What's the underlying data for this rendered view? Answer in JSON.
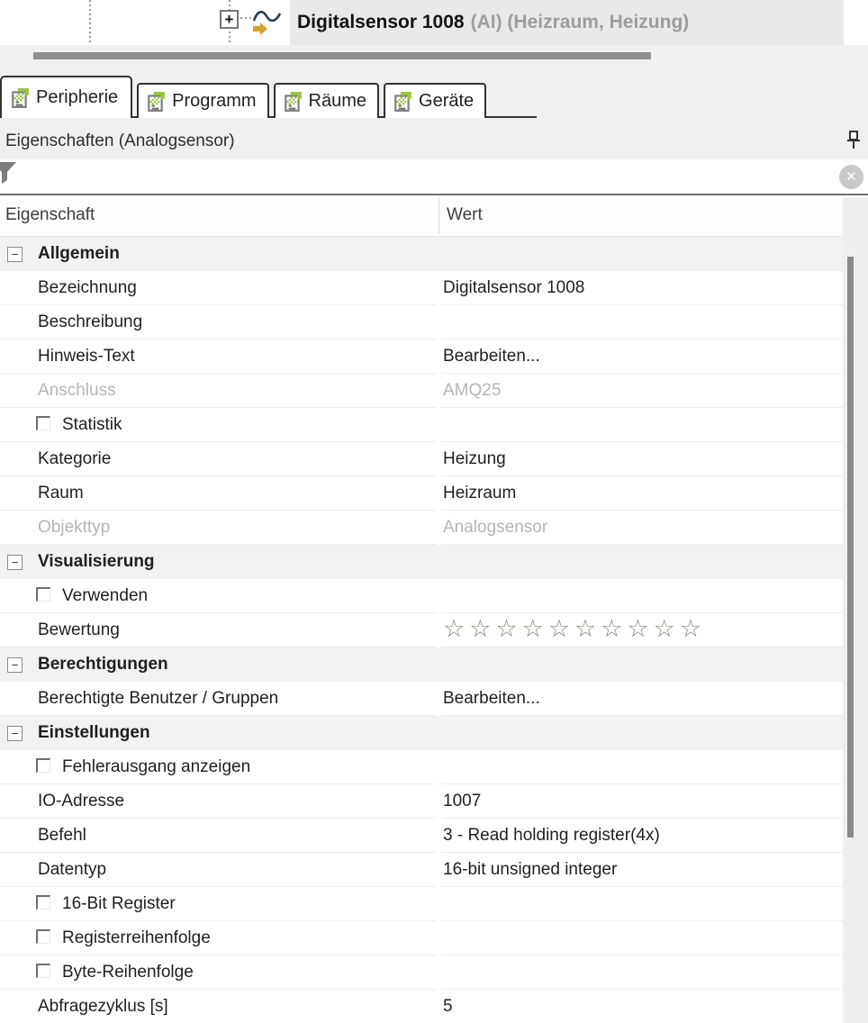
{
  "tree": {
    "item_title": "Digitalsensor 1008",
    "item_suffix": "(AI) (Heizraum, Heizung)"
  },
  "tabs": [
    {
      "label": "Peripherie",
      "active": true
    },
    {
      "label": "Programm",
      "active": false
    },
    {
      "label": "Räume",
      "active": false
    },
    {
      "label": "Geräte",
      "active": false
    }
  ],
  "panel": {
    "title": "Eigenschaften (Analogsensor)",
    "filter": {
      "value": "",
      "placeholder": ""
    },
    "columns": {
      "property": "Eigenschaft",
      "value": "Wert"
    }
  },
  "icons": {
    "clear": "✕",
    "expand": "+",
    "collapse": "−",
    "star_outline": "☆"
  },
  "colors": {
    "accent_green": "#9dc544",
    "arrow_gold": "#d4a033",
    "wave_navy": "#2b3a52",
    "selection_gray": "#e9e9e9",
    "disabled_text": "#b5b5b5",
    "section_bg": "#f2f2f2"
  },
  "properties": [
    {
      "type": "section",
      "label": "Allgemein"
    },
    {
      "type": "row",
      "label": "Bezeichnung",
      "value": "Digitalsensor 1008"
    },
    {
      "type": "row",
      "label": "Beschreibung",
      "value": ""
    },
    {
      "type": "row",
      "label": "Hinweis-Text",
      "value": "Bearbeiten..."
    },
    {
      "type": "row",
      "label": "Anschluss",
      "value": "AMQ25",
      "disabled": true
    },
    {
      "type": "row",
      "label": "Statistik",
      "value": "",
      "checkbox": true,
      "checked": false
    },
    {
      "type": "row",
      "label": "Kategorie",
      "value": "Heizung"
    },
    {
      "type": "row",
      "label": "Raum",
      "value": "Heizraum"
    },
    {
      "type": "row",
      "label": "Objekttyp",
      "value": "Analogsensor",
      "disabled": true
    },
    {
      "type": "section",
      "label": "Visualisierung"
    },
    {
      "type": "row",
      "label": "Verwenden",
      "value": "",
      "checkbox": true,
      "checked": false
    },
    {
      "type": "row",
      "label": "Bewertung",
      "value": "",
      "stars": 10,
      "stars_filled": 0
    },
    {
      "type": "section",
      "label": "Berechtigungen"
    },
    {
      "type": "row",
      "label": "Berechtigte Benutzer / Gruppen",
      "value": "Bearbeiten..."
    },
    {
      "type": "section",
      "label": "Einstellungen"
    },
    {
      "type": "row",
      "label": "Fehlerausgang anzeigen",
      "value": "",
      "checkbox": true,
      "checked": false
    },
    {
      "type": "row",
      "label": "IO-Adresse",
      "value": "1007"
    },
    {
      "type": "row",
      "label": "Befehl",
      "value": "3 - Read holding register(4x)"
    },
    {
      "type": "row",
      "label": "Datentyp",
      "value": "16-bit unsigned integer"
    },
    {
      "type": "row",
      "label": "16-Bit Register",
      "value": "",
      "checkbox": true,
      "checked": false
    },
    {
      "type": "row",
      "label": "Registerreihenfolge",
      "value": "",
      "checkbox": true,
      "checked": false
    },
    {
      "type": "row",
      "label": "Byte-Reihenfolge",
      "value": "",
      "checkbox": true,
      "checked": false
    },
    {
      "type": "row",
      "label": "Abfragezyklus [s]",
      "value": "5"
    }
  ]
}
